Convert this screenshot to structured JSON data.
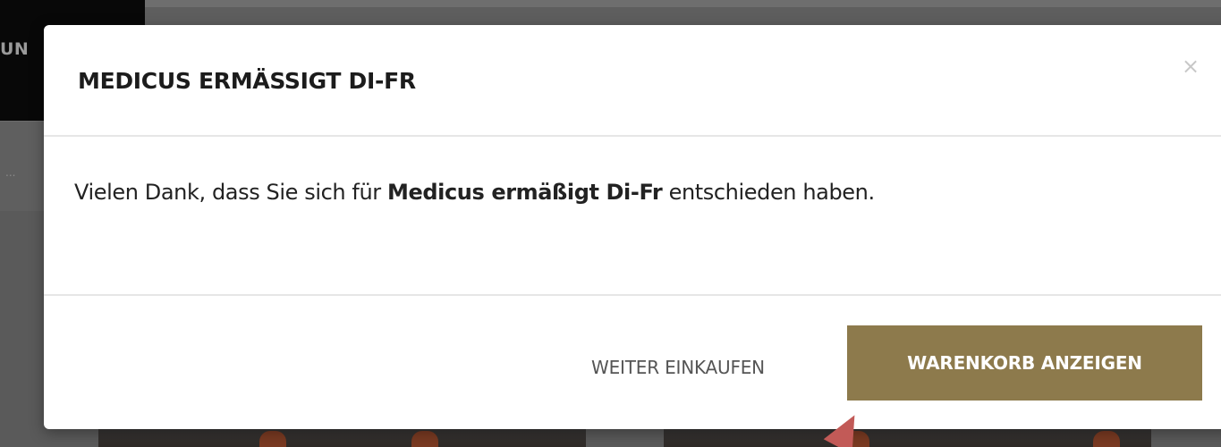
{
  "background": {
    "nav_fragment": "UN",
    "row_dots": "..."
  },
  "modal": {
    "title": "MEDICUS ERMÄSSIGT DI-FR",
    "close_glyph": "×",
    "message": {
      "before": "Vielen Dank, dass Sie sich für ",
      "product": "Medicus ermäßigt Di-Fr",
      "after": " entschieden haben."
    },
    "buttons": {
      "continue_label": "WEITER EINKAUFEN",
      "cart_label": "WARENKORB ANZEIGEN"
    }
  },
  "colors": {
    "accent_button": "#8d7a4c",
    "overlay": "#5e5e5e",
    "annotation_arrow": "#c25a57"
  },
  "icons": {
    "close": "close-icon",
    "pointer": "annotation-arrow"
  }
}
